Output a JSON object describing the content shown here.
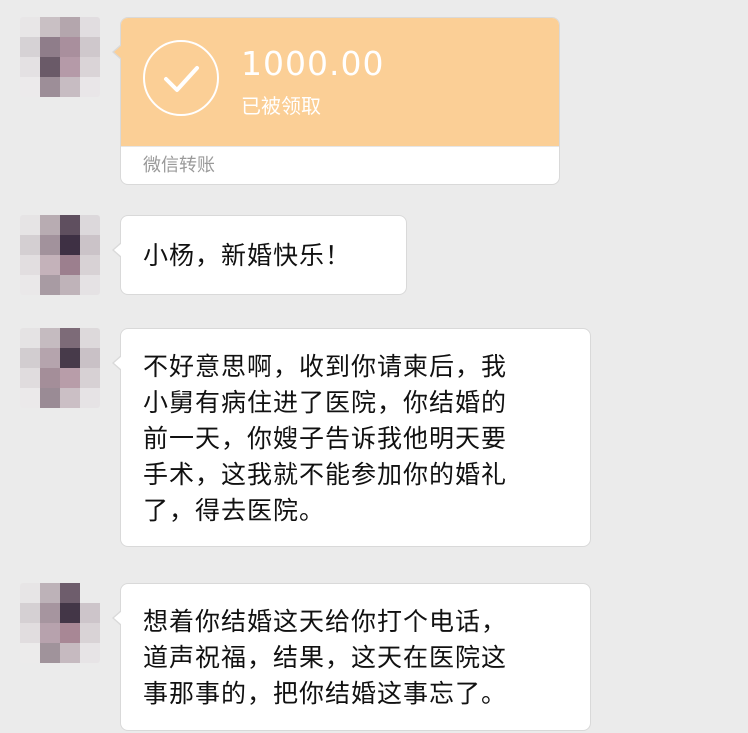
{
  "transfer": {
    "amount": "1000.00",
    "status": "已被领取",
    "label": "微信转账"
  },
  "messages": [
    {
      "text": "小杨，新婚快乐！"
    },
    {
      "text": "不好意思啊，收到你请柬后，我\n小舅有病住进了医院，你结婚的\n前一天，你嫂子告诉我他明天要\n手术，这我就不能参加你的婚礼\n了，得去医院。"
    },
    {
      "text": "想着你结婚这天给你打个电话，\n道声祝福，结果，这天在医院这\n事那事的，把你结婚这事忘了。"
    }
  ],
  "colors": {
    "background": "#ebebeb",
    "transfer_orange": "#fbcf96",
    "bubble": "#ffffff"
  }
}
